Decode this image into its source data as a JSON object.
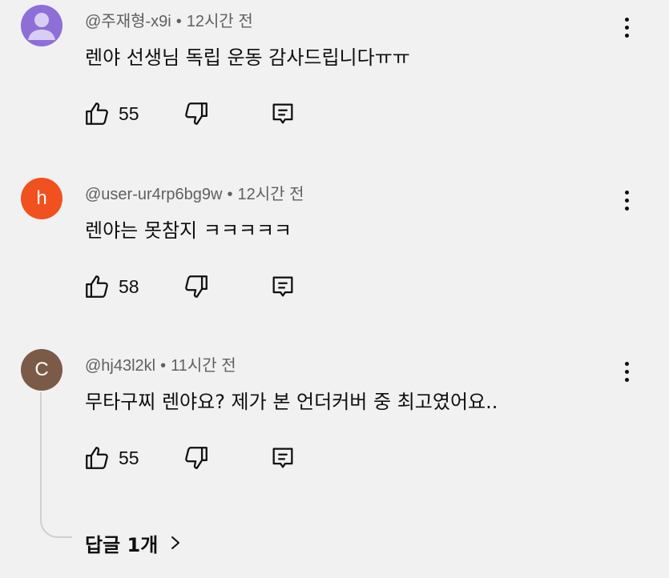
{
  "comments": [
    {
      "author": "@주재형-x9i",
      "separator": "•",
      "time": "12시간 전",
      "text": "렌야 선생님 독립 운동 감사드립니다ㅠㅠ",
      "likes": "55",
      "avatar": {
        "type": "default-profile-icon",
        "color": "#8e6fd8"
      }
    },
    {
      "author": "@user-ur4rp6bg9w",
      "separator": "•",
      "time": "12시간 전",
      "text": "렌야는 못참지 ㅋㅋㅋㅋㅋ",
      "likes": "58",
      "avatar": {
        "type": "letter",
        "letter": "h",
        "color": "#f0511e"
      }
    },
    {
      "author": "@hj43l2kl",
      "separator": "•",
      "time": "11시간 전",
      "text": "무타구찌 렌야요? 제가 본 언더커버 중 최고였어요..",
      "likes": "55",
      "avatar": {
        "type": "letter",
        "letter": "C",
        "color": "#7b5a48"
      }
    }
  ],
  "replies_label": "답글 1개",
  "icons": {
    "like": "thumbs-up-icon",
    "dislike": "thumbs-down-icon",
    "reply": "comment-reply-icon",
    "more": "more-vert-icon",
    "expand": "chevron-right-icon"
  }
}
